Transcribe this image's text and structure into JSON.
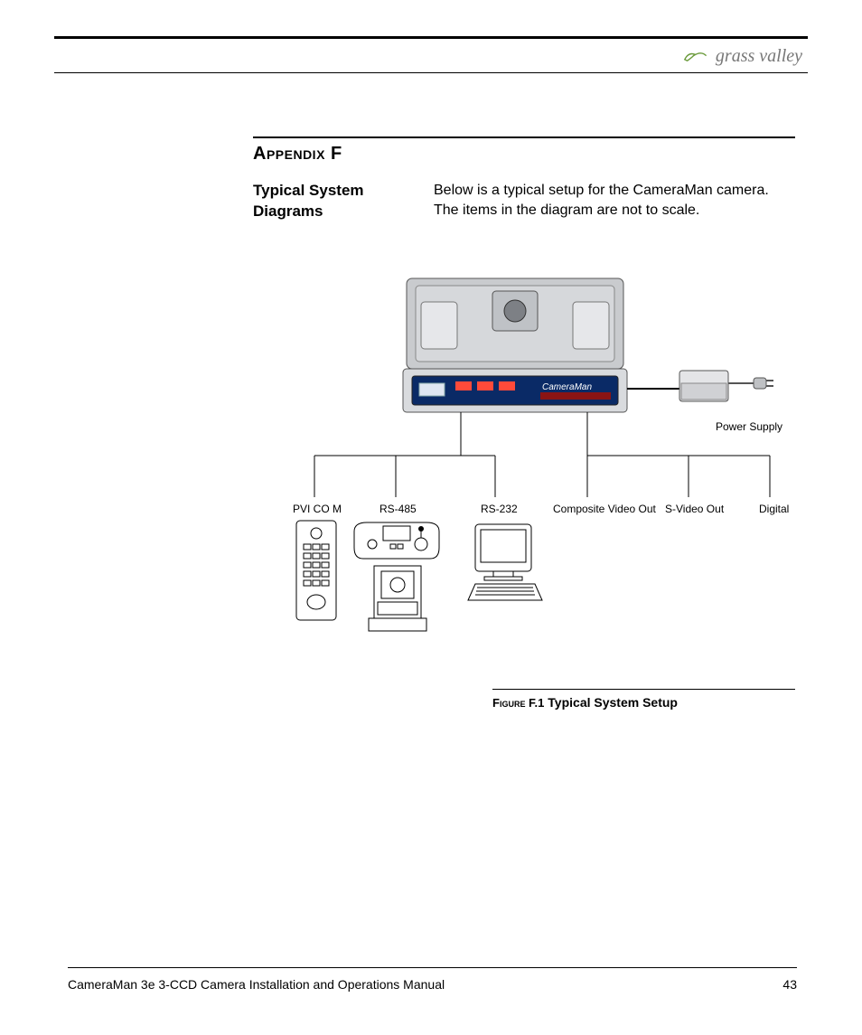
{
  "brand": {
    "name": "grass valley"
  },
  "appendix": {
    "title": "Appendix F",
    "section_heading": "Typical System Diagrams",
    "section_body": "Below is a typical setup for the CameraMan camera. The items in the diagram are not to scale."
  },
  "diagram": {
    "power_supply": "Power  Supply",
    "pvi_com": "PVI  CO M",
    "rs485": "RS-485",
    "rs232": "RS-232",
    "composite": "Composite Video Out",
    "svideo": "S-Video Out",
    "digital": "Digital",
    "camera_brand": "CameraMan"
  },
  "caption": {
    "label": "Figure F.1",
    "title": "Typical System Setup"
  },
  "footer": {
    "doc_title": "CameraMan 3e 3-CCD Camera Installation and Operations Manual",
    "page_number": "43"
  }
}
